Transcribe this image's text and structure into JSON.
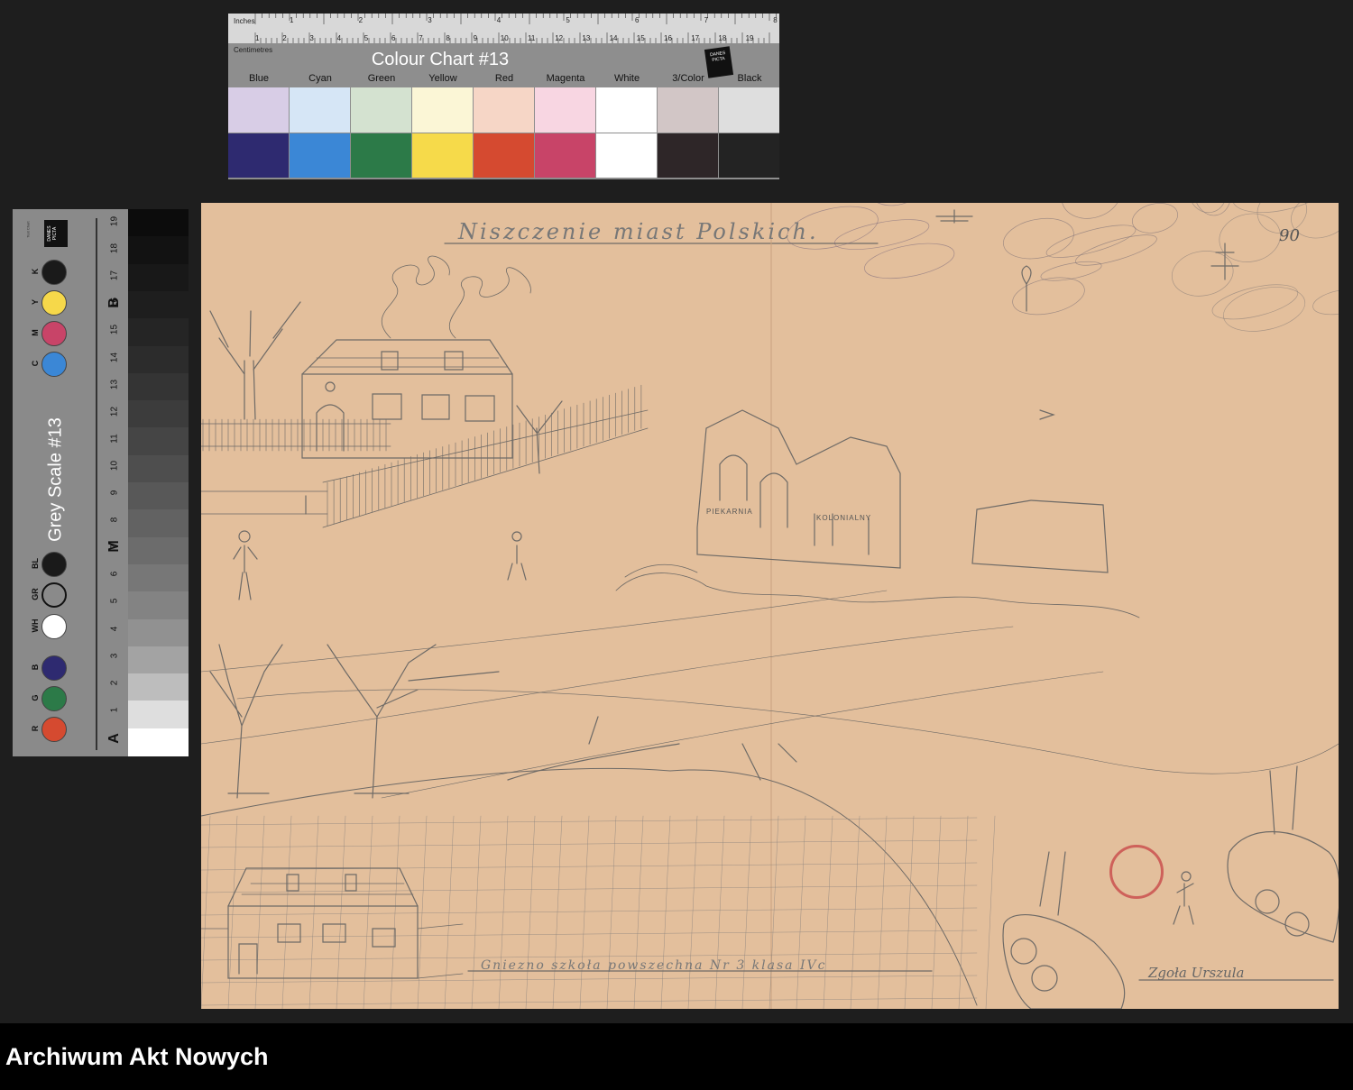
{
  "colour_chart": {
    "title": "Colour Chart #13",
    "ruler_inches_label": "Inches",
    "ruler_cm_label": "Centimetres",
    "inch_ticks": [
      "1",
      "2",
      "3",
      "4",
      "5",
      "6",
      "7",
      "8"
    ],
    "cm_ticks": [
      "1",
      "2",
      "3",
      "4",
      "5",
      "6",
      "7",
      "8",
      "9",
      "10",
      "11",
      "12",
      "13",
      "14",
      "15",
      "16",
      "17",
      "18",
      "19"
    ],
    "logo": "DANES PICTA",
    "swatches": [
      {
        "name": "Blue",
        "light": "#d8cde6",
        "dark": "#2e2a70"
      },
      {
        "name": "Cyan",
        "light": "#d6e6f6",
        "dark": "#3b87d6"
      },
      {
        "name": "Green",
        "light": "#d4e2d0",
        "dark": "#2c7a48"
      },
      {
        "name": "Yellow",
        "light": "#fbf6d6",
        "dark": "#f6da4a"
      },
      {
        "name": "Red",
        "light": "#f6d6c6",
        "dark": "#d54a30"
      },
      {
        "name": "Magenta",
        "light": "#f8d6e2",
        "dark": "#c84468"
      },
      {
        "name": "White",
        "light": "#ffffff",
        "dark": "#ffffff"
      },
      {
        "name": "3/Color",
        "light": "#d2c6c6",
        "dark": "#2e2628"
      },
      {
        "name": "Black",
        "light": "#dedede",
        "dark": "#232323"
      }
    ]
  },
  "grey_scale": {
    "title": "Grey Scale #13",
    "logo": "DANES PICTA",
    "small_text": "Test Chart",
    "dots": [
      {
        "label": "K",
        "color": "#1a1a1a"
      },
      {
        "label": "Y",
        "color": "#f6d84a"
      },
      {
        "label": "M",
        "color": "#c84468"
      },
      {
        "label": "C",
        "color": "#3b87d6"
      },
      {
        "label": "BL",
        "color": "#1a1a1a"
      },
      {
        "label": "GR",
        "color": "#8a8a8a"
      },
      {
        "label": "WH",
        "color": "#ffffff"
      },
      {
        "label": "B",
        "color": "#2e2a70"
      },
      {
        "label": "G",
        "color": "#2c7a48"
      },
      {
        "label": "R",
        "color": "#d54a30"
      }
    ],
    "numbers": [
      "19",
      "18",
      "17",
      "16",
      "15",
      "14",
      "13",
      "12",
      "11",
      "10",
      "9",
      "8",
      "7",
      "6",
      "5",
      "4",
      "3",
      "2",
      "1"
    ],
    "letters": [
      "B",
      "M",
      "A"
    ],
    "steps": [
      "#0c0c0c",
      "#121212",
      "#181818",
      "#1e1e1e",
      "#252525",
      "#2c2c2c",
      "#343434",
      "#3c3c3c",
      "#454545",
      "#4e4e4e",
      "#585858",
      "#626262",
      "#6c6c6c",
      "#777777",
      "#838383",
      "#919191",
      "#a3a3a3",
      "#bdbdbd",
      "#dedede",
      "#ffffff"
    ]
  },
  "drawing": {
    "title": "Niszczenie miast Polskich.",
    "page_number": "90",
    "shop_sign_1": "PIEKARNIA",
    "shop_sign_2": "KOLONIALNY",
    "school_line": "Gniezno szkoła powszechna Nr 3 klasa IVc",
    "author": "Zgoła Urszula",
    "paper_color": "#e3bf9c",
    "pencil_color": "#6e6a66"
  },
  "footer": {
    "text": "Archiwum Akt Nowych"
  }
}
